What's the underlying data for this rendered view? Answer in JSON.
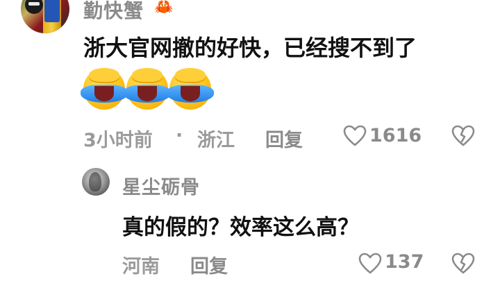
{
  "comment": {
    "username": "勤快蟹",
    "username_icon": "crab-icon",
    "text": "浙大官网撤的好快，已经搜不到了",
    "emojis": [
      "facepalm-crying-emoji",
      "facepalm-crying-emoji",
      "facepalm-crying-emoji"
    ],
    "time": "3小时前",
    "separator": "·",
    "location": "浙江",
    "reply_label": "回复",
    "like_count": "1616",
    "like_icon": "heart-outline-icon",
    "dislike_icon": "broken-heart-icon"
  },
  "reply": {
    "username": "星尘砺骨",
    "text": "真的假的？效率这么高？",
    "location": "河南",
    "reply_label": "回复",
    "like_count": "137",
    "like_icon": "heart-outline-icon",
    "dislike_icon": "broken-heart-icon"
  },
  "colors": {
    "text_primary": "#111111",
    "text_secondary": "#8a8a8a",
    "background": "#ffffff"
  }
}
